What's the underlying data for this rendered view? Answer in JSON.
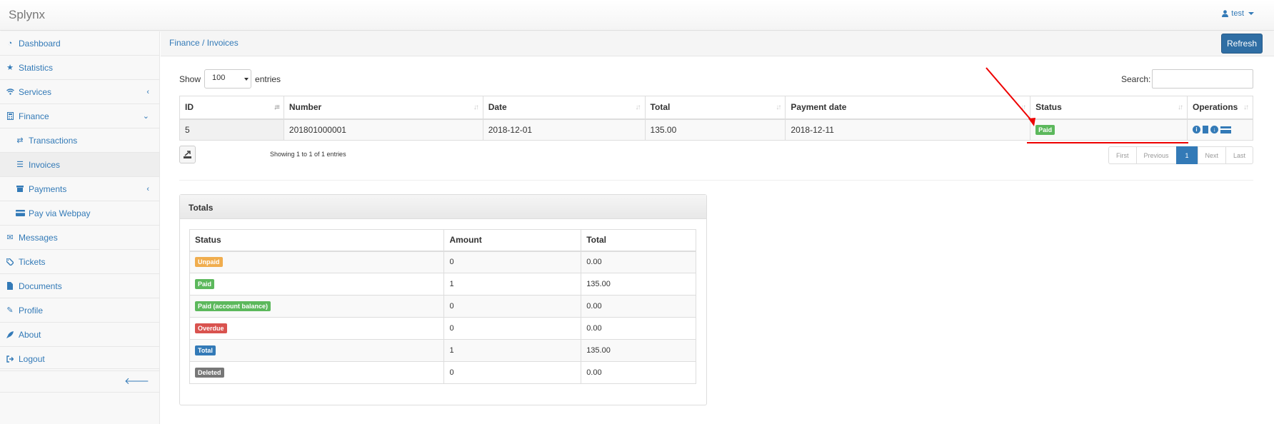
{
  "app": {
    "brand": "Splynx",
    "user": "test"
  },
  "sidebar": {
    "items": [
      {
        "label": "Dashboard",
        "icon": "dashboard-icon"
      },
      {
        "label": "Statistics",
        "icon": "star-icon"
      },
      {
        "label": "Services",
        "icon": "wifi-icon",
        "arrow": "‹"
      },
      {
        "label": "Finance",
        "icon": "calculator-icon",
        "arrow": "⌄"
      },
      {
        "label": "Transactions",
        "icon": "exchange-icon"
      },
      {
        "label": "Invoices",
        "icon": "list-icon"
      },
      {
        "label": "Payments",
        "icon": "archive-icon",
        "arrow": "‹"
      },
      {
        "label": "Pay via Webpay",
        "icon": "credit-card-icon"
      },
      {
        "label": "Messages",
        "icon": "envelope-icon"
      },
      {
        "label": "Tickets",
        "icon": "ticket-icon"
      },
      {
        "label": "Documents",
        "icon": "file-icon"
      },
      {
        "label": "Profile",
        "icon": "pencil-icon"
      },
      {
        "label": "About",
        "icon": "rocket-icon"
      },
      {
        "label": "Logout",
        "icon": "sign-out-icon"
      }
    ]
  },
  "header": {
    "breadcrumb": "Finance / Invoices",
    "refresh_label": "Refresh"
  },
  "controls": {
    "show_label": "Show",
    "entries_label": "entries",
    "page_size": "100",
    "search_label": "Search:"
  },
  "invoices": {
    "columns": [
      "ID",
      "Number",
      "Date",
      "Total",
      "Payment date",
      "Status",
      "Operations"
    ],
    "rows": [
      {
        "id": "5",
        "number": "201801000001",
        "date": "2018-12-01",
        "total": "135.00",
        "payment_date": "2018-12-11",
        "status": "Paid"
      }
    ],
    "info": "Showing 1 to 1 of 1 entries",
    "pager": {
      "first": "First",
      "previous": "Previous",
      "current": "1",
      "next": "Next",
      "last": "Last"
    }
  },
  "totals": {
    "title": "Totals",
    "columns": [
      "Status",
      "Amount",
      "Total"
    ],
    "rows": [
      {
        "status": "Unpaid",
        "amount": "0",
        "total": "0.00",
        "color": "#f0ad4e"
      },
      {
        "status": "Paid",
        "amount": "1",
        "total": "135.00",
        "color": "#5cb85c"
      },
      {
        "status": "Paid (account balance)",
        "amount": "0",
        "total": "0.00",
        "color": "#5cb85c"
      },
      {
        "status": "Overdue",
        "amount": "0",
        "total": "0.00",
        "color": "#d9534f"
      },
      {
        "status": "Total",
        "amount": "1",
        "total": "135.00",
        "color": "#337ab7"
      },
      {
        "status": "Deleted",
        "amount": "0",
        "total": "0.00",
        "color": "#777777"
      }
    ]
  },
  "colors": {
    "link": "#337ab7",
    "refresh": "#2f6ea4",
    "annotation": "#e00000"
  }
}
